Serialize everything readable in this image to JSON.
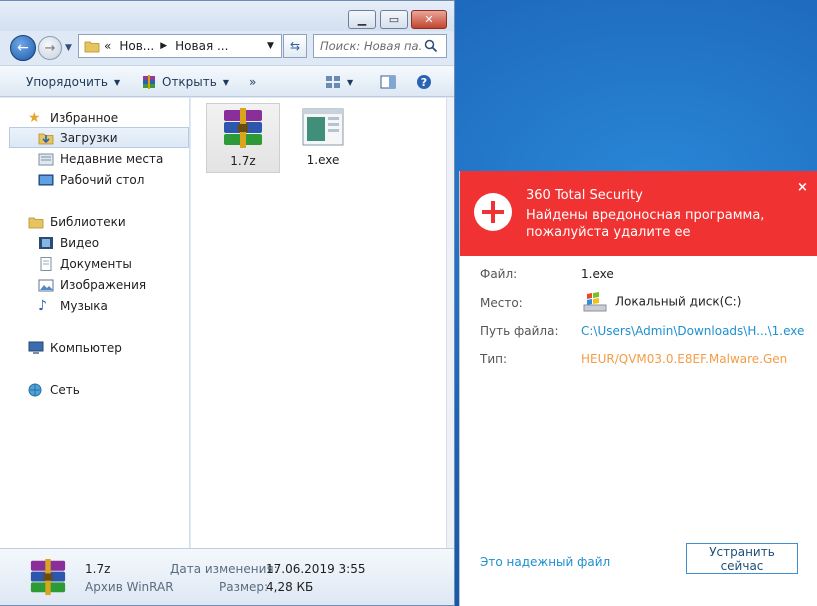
{
  "explorer": {
    "address": {
      "crumbs": [
        "«",
        "Нов...",
        "Новая ..."
      ]
    },
    "search": {
      "placeholder": "Поиск: Новая па..."
    },
    "toolbar": {
      "organize": "Упорядочить",
      "open": "Открыть",
      "more": "»"
    },
    "nav": {
      "favorites": "Избранное",
      "downloads": "Загрузки",
      "recent": "Недавние места",
      "desktop": "Рабочий стол",
      "libraries": "Библиотеки",
      "video": "Видео",
      "documents": "Документы",
      "pictures": "Изображения",
      "music": "Музыка",
      "computer": "Компьютер",
      "network": "Сеть"
    },
    "files": [
      {
        "name": "1.7z",
        "icon": "winrar-archive-icon"
      },
      {
        "name": "1.exe",
        "icon": "exe-window-icon"
      }
    ],
    "details": {
      "name": "1.7z",
      "type": "Архив WinRAR",
      "modified_label": "Дата изменения:",
      "modified_value": "17.06.2019 3:55",
      "size_label": "Размер:",
      "size_value": "4,28 КБ"
    }
  },
  "popup": {
    "title": "360 Total Security",
    "message": "Найдены вредоносная программа, пожалуйста удалите ее",
    "close": "×",
    "file_label": "Файл:",
    "file_value": "1.exe",
    "location_label": "Место:",
    "location_value": "Локальный диск(C:)",
    "path_label": "Путь файла:",
    "path_value": "C:\\Users\\Admin\\Downloads\\H...\\1.exe",
    "type_label": "Тип:",
    "type_value": "HEUR/QVM03.0.E8EF.Malware.Gen",
    "trust_link": "Это надежный файл",
    "fix_button": "Устранить сейчас",
    "colors": {
      "header": "#f03232",
      "link": "#1e8fd0",
      "warn": "#f39c45"
    }
  }
}
